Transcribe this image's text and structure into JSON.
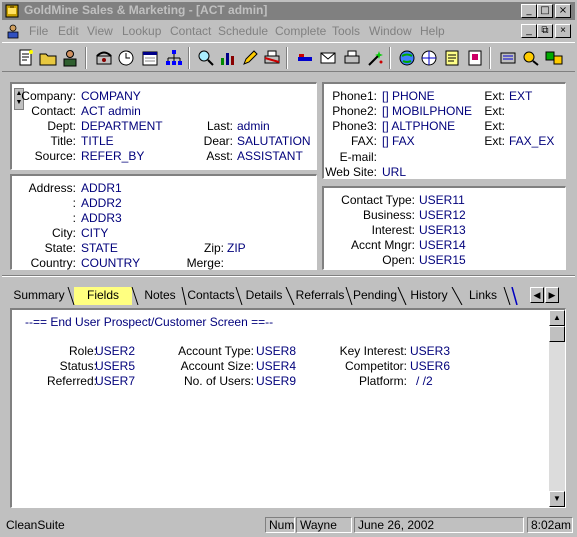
{
  "window": {
    "title": "GoldMine Sales & Marketing - [ACT admin]",
    "buttons": {
      "minimize": "_",
      "maximize": "□",
      "close": "×"
    }
  },
  "menu": [
    "File",
    "Edit",
    "View",
    "Lookup",
    "Contact",
    "Schedule",
    "Complete",
    "Tools",
    "Window",
    "Help"
  ],
  "mdi_buttons": {
    "minimize": "_",
    "restore": "⧉",
    "close": "×"
  },
  "toolbar": {
    "icons": [
      "new-record-icon",
      "open-folder-icon",
      "user-icon",
      "phone-icon",
      "clock-icon",
      "calendar-icon",
      "org-chart-icon",
      "search-icon",
      "bar-graph-icon",
      "pen-icon",
      "printer-icon",
      "email-icon",
      "envelope-icon",
      "print-icon",
      "magic-wand-icon",
      "globe-icon",
      "web-icon",
      "notes-icon",
      "attach-icon",
      "lookup-icon",
      "help-icon",
      "sync-icon"
    ]
  },
  "contact": {
    "company_label": "Company:",
    "company": "COMPANY",
    "contact_label": "Contact:",
    "contact": "ACT admin",
    "dept_label": "Dept:",
    "dept": "DEPARTMENT",
    "last_label": "Last:",
    "last": "admin",
    "title_label": "Title:",
    "title": "TITLE",
    "dear_label": "Dear:",
    "dear": "SALUTATION",
    "source_label": "Source:",
    "source": "REFER_BY",
    "asst_label": "Asst:",
    "asst": "ASSISTANT"
  },
  "phones": {
    "phone1_label": "Phone1:",
    "phone1": "[] PHONE",
    "ext1_label": "Ext:",
    "ext1": "EXT",
    "phone2_label": "Phone2:",
    "phone2": "[] MOBILPHONE",
    "ext2_label": "Ext:",
    "phone3_label": "Phone3:",
    "phone3": "[] ALTPHONE",
    "ext3_label": "Ext:",
    "fax_label": "FAX:",
    "fax": "[] FAX",
    "ext4_label": "Ext:",
    "ext4": "FAX_EX",
    "email_label": "E-mail:",
    "website_label": "Web Site:",
    "website": "URL"
  },
  "address": {
    "address_label": "Address:",
    "address1": "ADDR1",
    "addr2_label": ":",
    "address2": "ADDR2",
    "addr3_label": ":",
    "address3": "ADDR3",
    "city_label": "City:",
    "city": "CITY",
    "state_label": "State:",
    "state": "STATE",
    "zip_label": "Zip:",
    "zip": "ZIP",
    "country_label": "Country:",
    "country": "COUNTRY",
    "merge_label": "Merge:"
  },
  "user_fields": {
    "contact_type_label": "Contact Type:",
    "contact_type": "USER11",
    "business_label": "Business:",
    "business": "USER12",
    "interest_label": "Interest:",
    "interest": "USER13",
    "accnt_mngr_label": "Accnt Mngr:",
    "accnt_mngr": "USER14",
    "open_label": "Open:",
    "open": "USER15"
  },
  "tabs": [
    "Summary",
    "Fields",
    "Notes",
    "Contacts",
    "Details",
    "Referrals",
    "Pending",
    "History",
    "Links"
  ],
  "active_tab": "Fields",
  "fields_view": {
    "heading": "--== End User Prospect/Customer Screen ==--",
    "role_label": "Role:",
    "role": "USER2",
    "status_label": "Status:",
    "status": "USER5",
    "referred_label": "Referred:",
    "referred": "USER7",
    "account_type_label": "Account Type:",
    "account_type": "USER8",
    "account_size_label": "Account Size:",
    "account_size": "USER4",
    "num_users_label": "No. of Users:",
    "num_users": "USER9",
    "key_interest_label": "Key Interest:",
    "key_interest": "USER3",
    "competitor_label": "Competitor:",
    "competitor": "USER6",
    "platform_label": "Platform:",
    "platform": "/  /2"
  },
  "statusbar": {
    "app": "CleanSuite",
    "num": "Num",
    "user": "Wayne",
    "date": "June 26, 2002",
    "time": "8:02am"
  },
  "colors": {
    "field_value": "#00007b",
    "active_tab": "#ffff80",
    "titlebar_inactive": "#808080"
  }
}
